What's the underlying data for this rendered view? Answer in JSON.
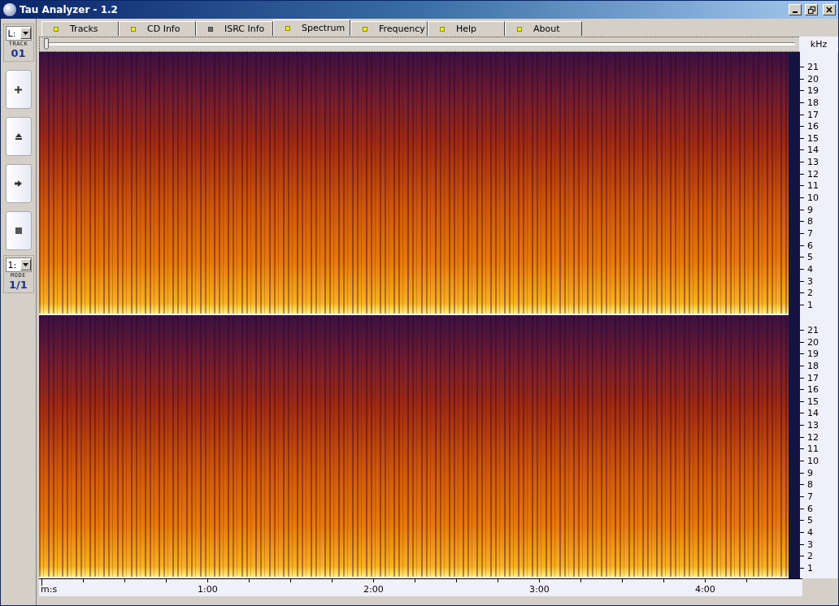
{
  "window": {
    "title": "Tau Analyzer - 1.2"
  },
  "sidebar": {
    "drive_select": "L:",
    "track_label": "TRACK",
    "track": "01",
    "mode_select": "1:",
    "mode_label": "MODE",
    "mode": "1/1"
  },
  "tabs": [
    {
      "label": "Tracks",
      "selected": false,
      "indicator_on": true
    },
    {
      "label": "CD Info",
      "selected": false,
      "indicator_on": true
    },
    {
      "label": "ISRC Info",
      "selected": false,
      "indicator_on": false
    },
    {
      "label": "Spectrum",
      "selected": true,
      "indicator_on": true
    },
    {
      "label": "Frequency",
      "selected": false,
      "indicator_on": true
    },
    {
      "label": "Help",
      "selected": false,
      "indicator_on": true
    },
    {
      "label": "About",
      "selected": false,
      "indicator_on": true
    }
  ],
  "position_slider": {
    "level": 0
  },
  "frequency_axis": {
    "unit": "kHz",
    "channels": [
      [
        "21",
        "20",
        "19",
        "18",
        "17",
        "16",
        "15",
        "14",
        "13",
        "12",
        "11",
        "10",
        "9",
        "8",
        "7",
        "6",
        "5",
        "4",
        "3",
        "2",
        "1"
      ],
      [
        "21",
        "20",
        "19",
        "18",
        "17",
        "16",
        "15",
        "14",
        "13",
        "12",
        "11",
        "10",
        "9",
        "8",
        "7",
        "6",
        "5",
        "4",
        "3",
        "2",
        "1"
      ]
    ]
  },
  "time_axis": {
    "unit": "m:s",
    "ticks": [
      "1:00",
      "2:00",
      "3:00",
      "4:00"
    ]
  }
}
